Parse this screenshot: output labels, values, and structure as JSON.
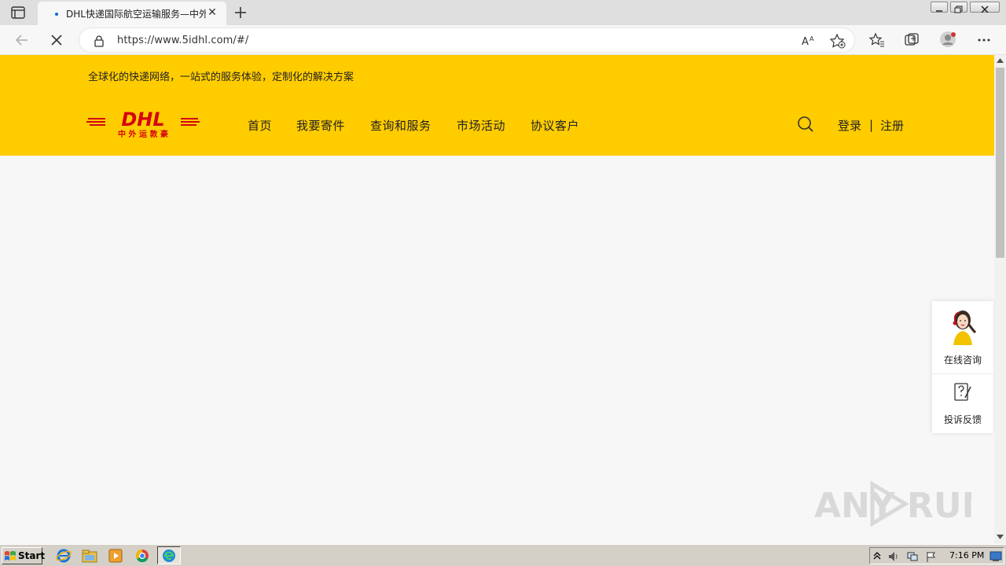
{
  "browser": {
    "tab_title": "DHL快递国际航空运输服务—中外",
    "url": "https://www.5idhl.com/#/",
    "new_tab": "+",
    "close_tab": "✕"
  },
  "page": {
    "slogan": "全球化的快递网络，一站式的服务体验，定制化的解决方案",
    "logo": {
      "main": "DHL",
      "sub": "中 外 运 敦 豪"
    },
    "nav": [
      {
        "label": "首页"
      },
      {
        "label": "我要寄件"
      },
      {
        "label": "查询和服务"
      },
      {
        "label": "市场活动"
      },
      {
        "label": "协议客户"
      }
    ],
    "login": "登录",
    "separator": "|",
    "register": "注册",
    "float_panel": {
      "online": "在线咨询",
      "complain": "投诉反馈"
    }
  },
  "watermark": {
    "left": "ANY",
    "right": "RUN"
  },
  "taskbar": {
    "start": "Start",
    "clock": "7:16 PM"
  },
  "colors": {
    "header_bg": "#ffcc00",
    "dhl_red": "#d40511",
    "page_bg": "#f7f7f7",
    "taskbar_bg": "#d4d0c8"
  }
}
